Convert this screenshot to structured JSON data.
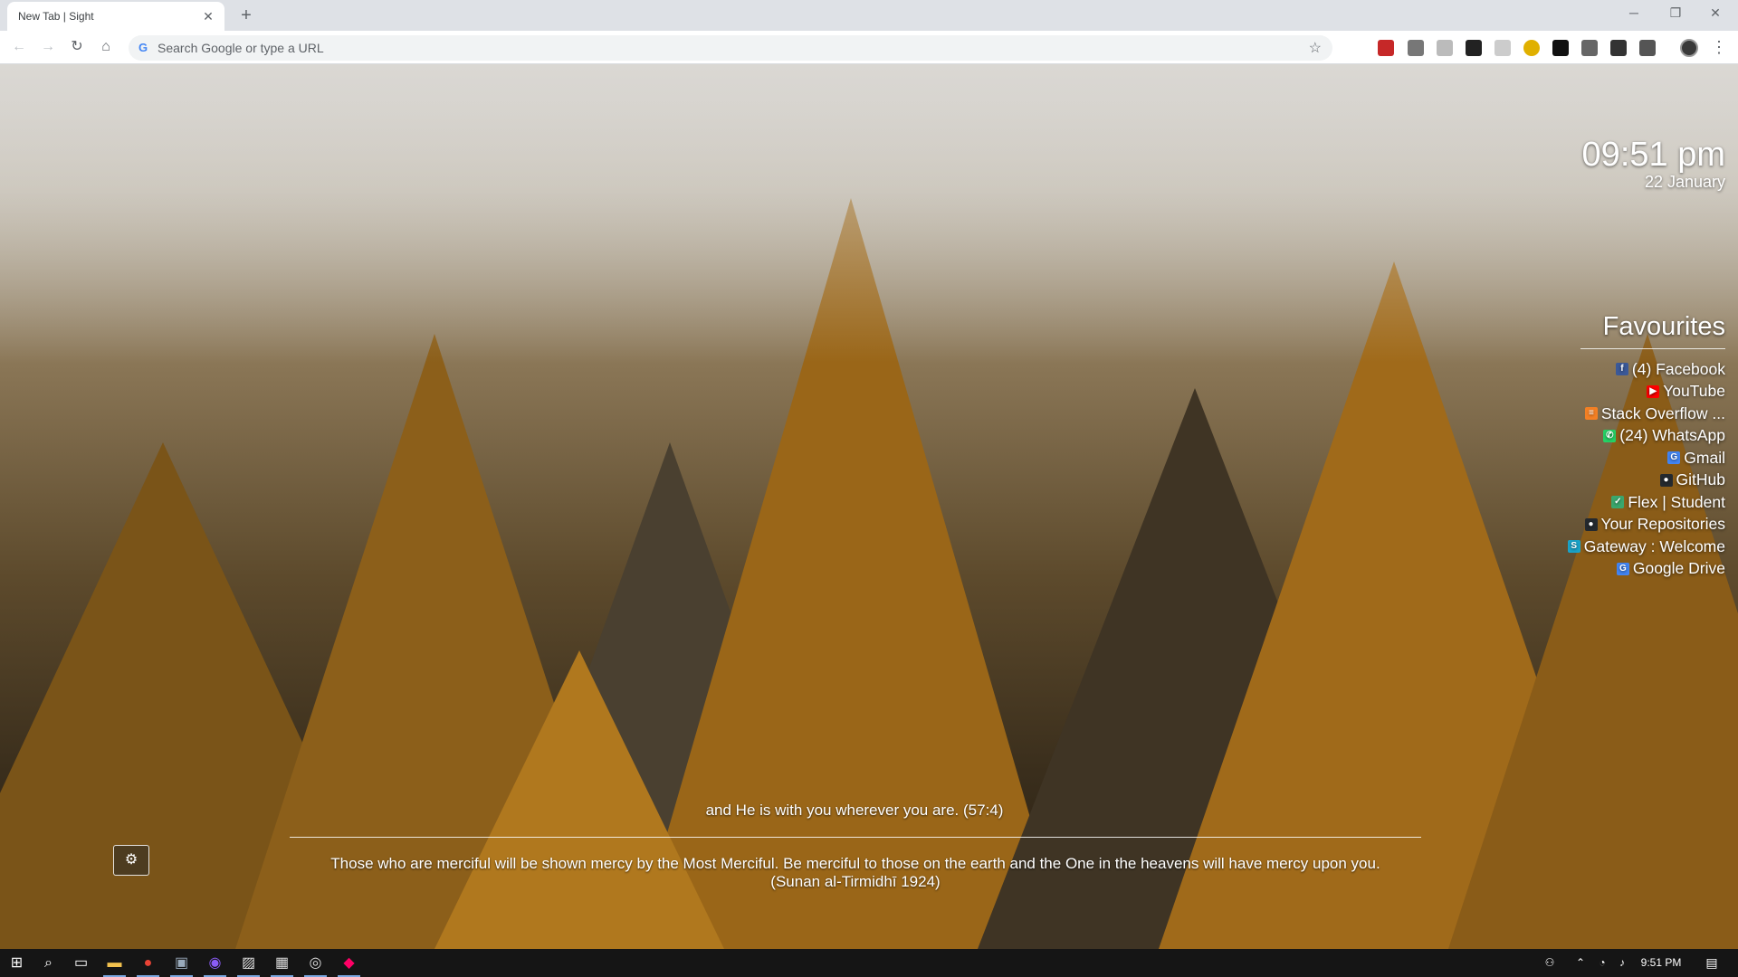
{
  "browser": {
    "tab_title": "New Tab | Sight",
    "tab_close": "✕",
    "new_tab": "+",
    "window_controls": {
      "minimize": "─",
      "restore": "❐",
      "close": "✕"
    },
    "omnibox_placeholder": "Search Google or type a URL",
    "omnibox_logo": "G"
  },
  "clock": {
    "time": "09:51 pm",
    "date": "22 January"
  },
  "favourites": {
    "title": "Favourites",
    "items": [
      {
        "label": "(4) Facebook",
        "icon": "facebook-icon",
        "glyph": "f",
        "color": "#3b5998"
      },
      {
        "label": "YouTube",
        "icon": "youtube-icon",
        "glyph": "▶",
        "color": "#ff0000"
      },
      {
        "label": "Stack Overflow ...",
        "icon": "stackoverflow-icon",
        "glyph": "≡",
        "color": "#f48024"
      },
      {
        "label": "(24) WhatsApp",
        "icon": "whatsapp-icon",
        "glyph": "✆",
        "color": "#25d366"
      },
      {
        "label": "Gmail",
        "icon": "google-icon",
        "glyph": "G",
        "color": "#4285f4"
      },
      {
        "label": "GitHub",
        "icon": "github-icon",
        "glyph": "●",
        "color": "#24292e"
      },
      {
        "label": "Flex | Student",
        "icon": "flex-icon",
        "glyph": "✓",
        "color": "#3aa76d"
      },
      {
        "label": "Your Repositories",
        "icon": "github-icon",
        "glyph": "●",
        "color": "#24292e"
      },
      {
        "label": "Gateway : Welcome",
        "icon": "gateway-icon",
        "glyph": "S",
        "color": "#1aa3c9"
      },
      {
        "label": "Google Drive",
        "icon": "google-icon",
        "glyph": "G",
        "color": "#4285f4"
      }
    ]
  },
  "quote": {
    "verse": "and He is with you wherever you are. (57:4)",
    "hadith_line1": "Those who are merciful will be shown mercy by the Most Merciful. Be merciful to those on the earth and the One in the heavens will have mercy upon you.",
    "hadith_line2": "(Sunan al-Tirmidhī 1924)"
  },
  "settings_button": "⚙",
  "taskbar": {
    "time": "9:51 PM"
  }
}
